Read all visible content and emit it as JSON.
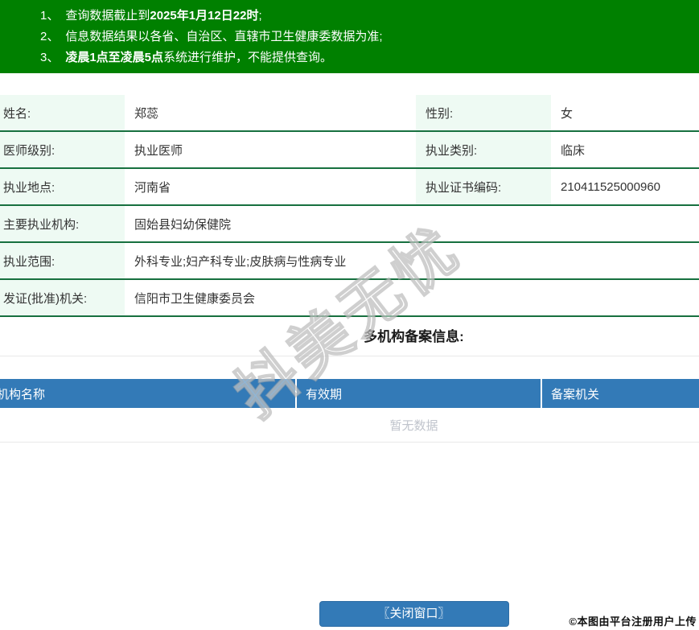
{
  "notices": [
    {
      "num": "1、",
      "pre": "查询数据截止到",
      "bold": "2025年1月12日22时",
      "post": ";"
    },
    {
      "num": "2、",
      "pre": "信息数据结果以各省、自治区、直辖市卫生健康委数据为准;",
      "bold": "",
      "post": ""
    },
    {
      "num": "3、",
      "pre": "",
      "bold": "凌晨1点至凌晨5点",
      "post": "系统进行维护，不能提供查询。"
    }
  ],
  "info": {
    "rows4col": [
      {
        "l1": "姓名:",
        "v1": "郑蕊",
        "l2": "性别:",
        "v2": "女"
      },
      {
        "l1": "医师级别:",
        "v1": "执业医师",
        "l2": "执业类别:",
        "v2": "临床"
      },
      {
        "l1": "执业地点:",
        "v1": "河南省",
        "l2": "执业证书编码:",
        "v2": "210411525000960"
      }
    ],
    "rows2col": [
      {
        "l": "主要执业机构:",
        "v": "固始县妇幼保健院"
      },
      {
        "l": "执业范围:",
        "v": "外科专业;妇产科专业;皮肤病与性病专业"
      },
      {
        "l": "发证(批准)机关:",
        "v": "信阳市卫生健康委员会"
      }
    ]
  },
  "filing_section": {
    "title": "多机构备案信息:",
    "columns": [
      "机构名称",
      "有效期",
      "备案机关"
    ],
    "empty_text": "暂无数据"
  },
  "footer": {
    "close_button": "〖关闭窗口〗",
    "copyright": "©本图由平台注册用户上传"
  },
  "watermark": "抖美无忧",
  "colors": {
    "banner_green": "#008000",
    "row_border_green": "#17703f",
    "label_bg_mint": "#eefaf3",
    "header_blue": "#337ab7",
    "button_blue": "#337ab7",
    "button_border": "#2e6da4",
    "empty_text_gray": "#c0c4cc",
    "divider_gray": "#e8e8e8"
  }
}
